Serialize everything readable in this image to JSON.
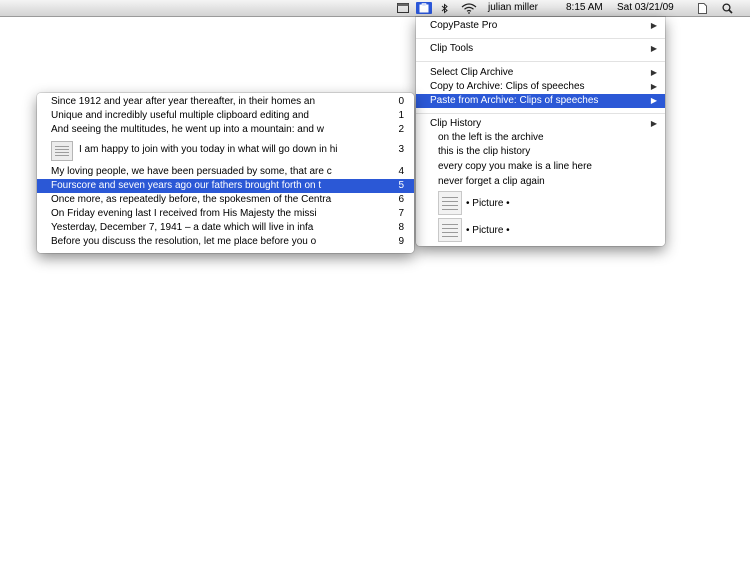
{
  "menubar": {
    "user": "julian miller",
    "time": "8:15 AM",
    "date": "Sat 03/21/09",
    "icons": [
      "window-icon",
      "clip-app-icon",
      "bluetooth-icon",
      "wifi-icon",
      "page-icon",
      "spotlight-icon"
    ]
  },
  "app_menu": {
    "items": [
      {
        "label": "CopyPaste Pro",
        "has_submenu": true
      },
      {
        "label": "Clip Tools",
        "has_submenu": true
      },
      {
        "label": "Select Clip Archive",
        "has_submenu": true
      },
      {
        "label": "Copy to Archive: Clips of speeches",
        "has_submenu": true
      },
      {
        "label": "Paste from Archive: Clips of speeches",
        "has_submenu": true,
        "selected": true
      },
      {
        "label": "Clip History",
        "has_submenu": true
      }
    ],
    "history_items": [
      "on the left is the archive",
      "this is the clip history",
      "every copy you make is a line here",
      "never forget a clip again"
    ],
    "picture_items": [
      "• Picture •",
      "• Picture •"
    ]
  },
  "clips_menu": {
    "items": [
      {
        "text": "Since 1912 and year after year thereafter, in their homes an",
        "num": "0"
      },
      {
        "text": "Unique and incredibly useful multiple clipboard editing and",
        "num": "1"
      },
      {
        "text": "And seeing the multitudes, he went up into a mountain: and w",
        "num": "2"
      },
      {
        "text": "I am happy to join with you today in what will go down in hi",
        "num": "3",
        "has_image": true
      },
      {
        "text": "My loving people, we have been persuaded by some, that are c",
        "num": "4"
      },
      {
        "text": "Fourscore and seven years ago our fathers brought forth on t",
        "num": "5",
        "selected": true
      },
      {
        "text": "Once more, as repeatedly before, the spokesmen of the Centra",
        "num": "6"
      },
      {
        "text": "On Friday evening last I received from His Majesty the missi",
        "num": "7"
      },
      {
        "text": "Yesterday, December 7, 1941 – a date which will live in infa",
        "num": "8"
      },
      {
        "text": "Before you discuss the resolution, let me place before you o",
        "num": "9"
      }
    ]
  },
  "colors": {
    "selection": "#2b58d6",
    "menubar_active": "#2a56d8"
  }
}
